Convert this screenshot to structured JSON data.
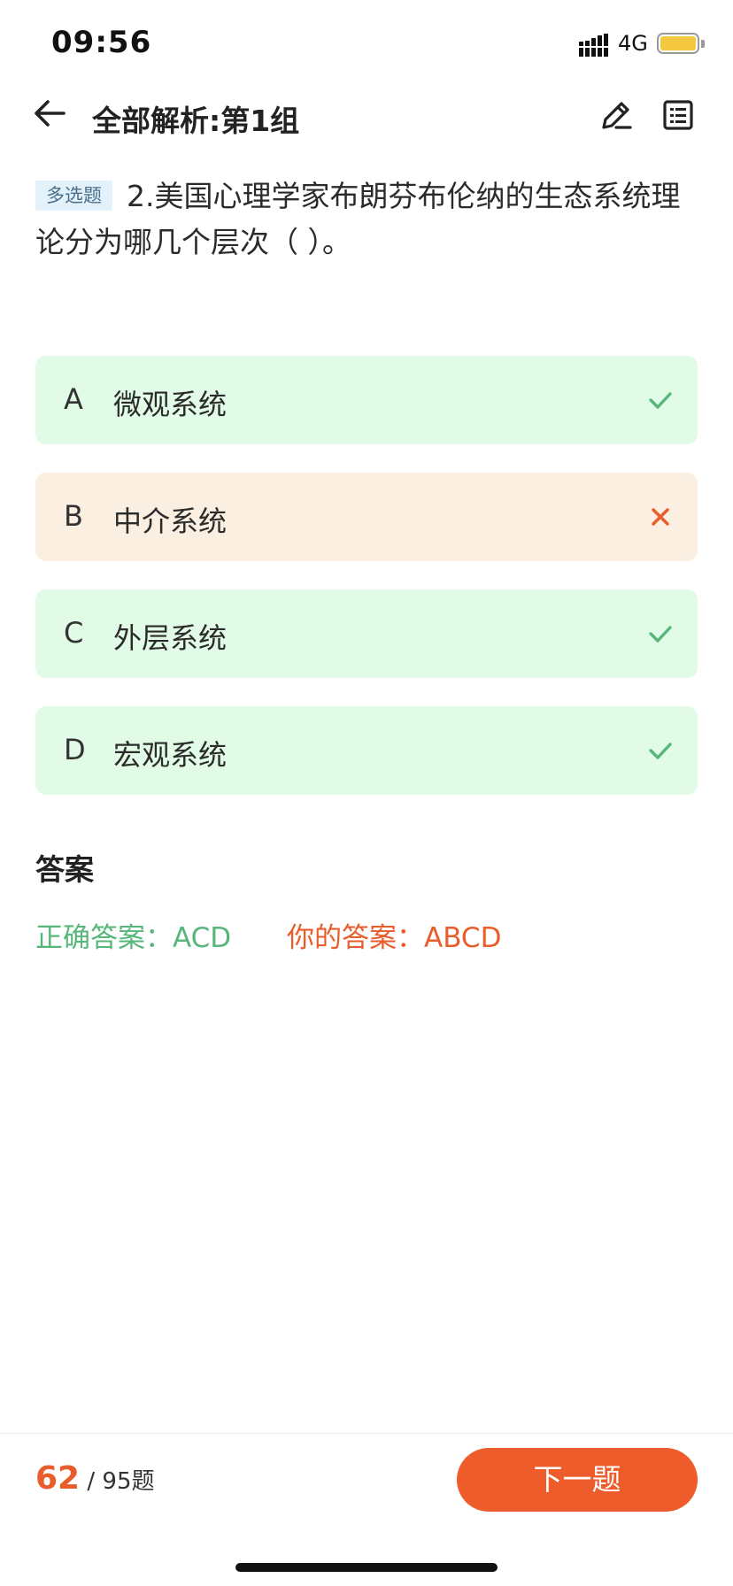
{
  "status_bar": {
    "time": "09:56",
    "network": "4G",
    "battery_color": "#f5c842"
  },
  "nav": {
    "title": "全部解析:第1组",
    "back_icon": "arrow-left-icon",
    "edit_icon": "pencil-icon",
    "list_icon": "list-icon"
  },
  "question": {
    "type_tag": "多选题",
    "text": "2.美国心理学家布朗芬布伦纳的生态系统理论分为哪几个层次（ ）。"
  },
  "options": [
    {
      "letter": "A",
      "text": "微观系统",
      "status": "correct"
    },
    {
      "letter": "B",
      "text": "中介系统",
      "status": "wrong"
    },
    {
      "letter": "C",
      "text": "外层系统",
      "status": "correct"
    },
    {
      "letter": "D",
      "text": "宏观系统",
      "status": "correct"
    }
  ],
  "answer": {
    "title": "答案",
    "correct": "正确答案：ACD",
    "yours": "你的答案：ABCD"
  },
  "footer": {
    "current": "62",
    "total": "/ 95题",
    "next_label": "下一题"
  },
  "colors": {
    "correct": "#57b77a",
    "wrong": "#e85d2b",
    "correct_bg": "#e2fbe6",
    "wrong_bg": "#fbefe1",
    "accent": "#ed5c2a"
  }
}
